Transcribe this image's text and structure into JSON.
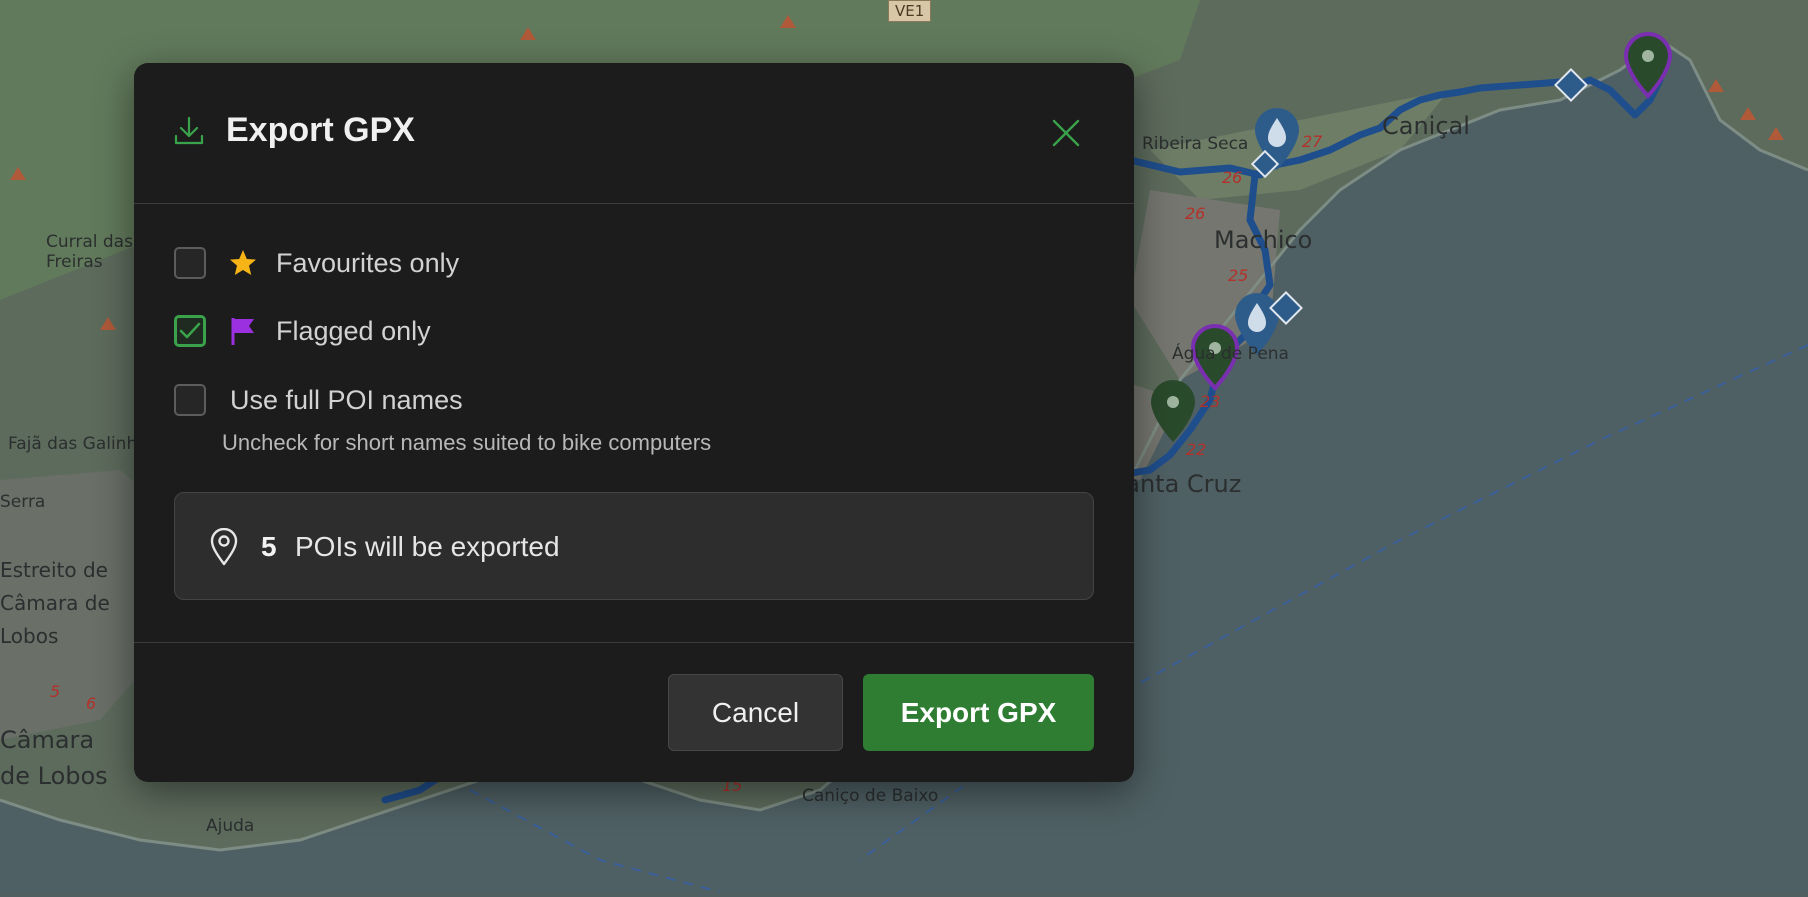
{
  "map": {
    "labels": [
      "Caniçal",
      "Machico",
      "Ribeira Seca",
      "Água de Pena",
      "Santa Cruz",
      "Curral das Freiras",
      "Fajã das Galinhas",
      "Serra",
      "Estreito de Câmara de Lobos",
      "Câmara de Lobos",
      "Caniço de Baixo",
      "Ajuda",
      "VE1"
    ],
    "km_markers": [
      "27",
      "26",
      "26",
      "25",
      "23",
      "22",
      "5",
      "6",
      "15"
    ],
    "route_color": "#1f4e8c",
    "poi_colors": {
      "pin": "#2a4a2c",
      "flagged_outline": "#7a2fb0",
      "water": "#2e5c8a"
    }
  },
  "dialog": {
    "title": "Export GPX",
    "options": [
      {
        "label": "Favourites only",
        "checked": false,
        "icon": "star-icon"
      },
      {
        "label": "Flagged only",
        "checked": true,
        "icon": "flag-icon"
      },
      {
        "label": "Use full POI names",
        "checked": false
      }
    ],
    "hint": "Uncheck for short names suited to bike computers",
    "summary": {
      "count": "5",
      "text": "POIs will be exported",
      "icon": "map-pin-icon"
    },
    "buttons": {
      "cancel": "Cancel",
      "export": "Export GPX"
    },
    "colors": {
      "accent": "#2e7d32",
      "check": "#3aa24a",
      "star": "#f6b417",
      "flag": "#9b30e0"
    }
  }
}
